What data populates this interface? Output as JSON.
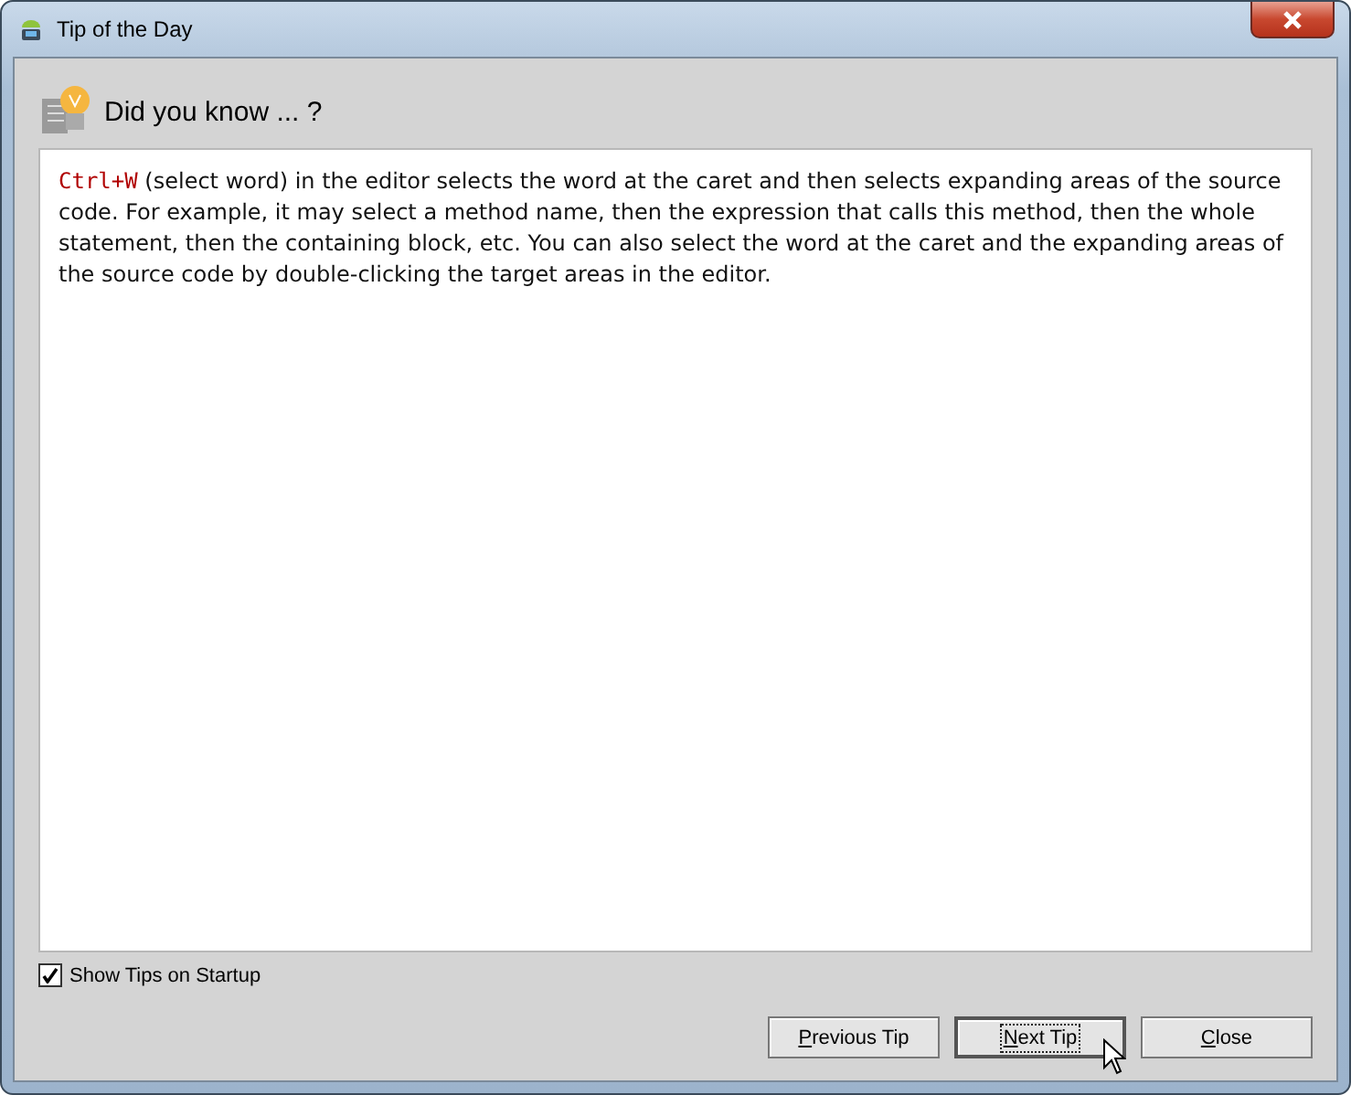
{
  "window": {
    "title": "Tip of the Day"
  },
  "heading": "Did you know ... ?",
  "tip": {
    "shortcut": "Ctrl+W",
    "text": " (select word) in the editor selects the word at the caret and then selects expanding areas of the source code. For example, it may select a method name, then the expression that calls this method, then the whole statement, then the containing block, etc. You can also select the word at the caret and the expanding areas of the source code by double-clicking the target areas in the editor."
  },
  "show_on_startup": {
    "label": "Show Tips on Startup",
    "checked": true
  },
  "buttons": [
    {
      "label": "Previous Tip",
      "focused": false
    },
    {
      "label": "Next Tip",
      "focused": true
    },
    {
      "label": "Close",
      "focused": false
    }
  ]
}
